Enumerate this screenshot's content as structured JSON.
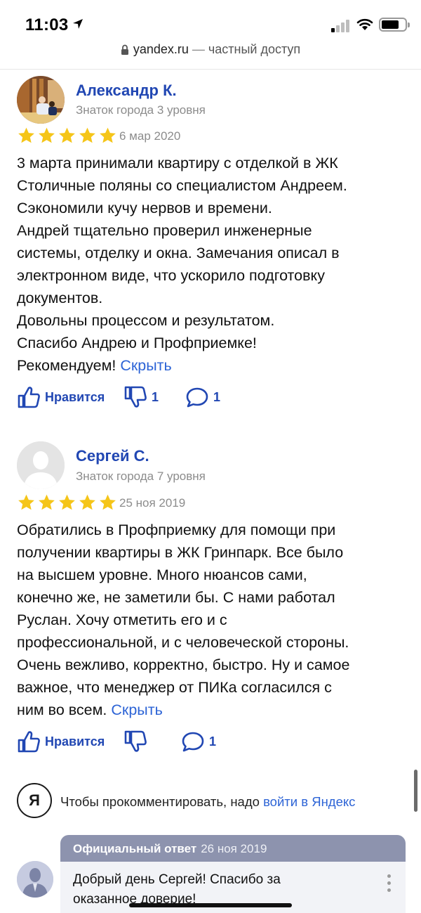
{
  "status_bar": {
    "time": "11:03"
  },
  "browser": {
    "domain": "yandex.ru",
    "separator": " — ",
    "access": "частный доступ"
  },
  "reviews": [
    {
      "author": "Александр К.",
      "level": "Знаток города 3 уровня",
      "rating": 5,
      "date": "6 мар 2020",
      "lines": [
        "3 марта принимали квартиру с отделкой в ЖК",
        "Столичные поляны со специалистом Андреем.",
        "Сэкономили кучу нервов и времени.",
        "Андрей тщательно проверил инженерные",
        "системы, отделку и окна. Замечания описал в",
        "электронном виде, что ускорило подготовку",
        "документов.",
        "Довольны процессом и результатом.",
        "Спасибо Андрею и Профприемке!",
        "Рекомендуем!"
      ],
      "hide_label": "Скрыть",
      "like_label": "Нравится",
      "dislike_count": "1",
      "comment_count": "1"
    },
    {
      "author": "Сергей С.",
      "level": "Знаток города 7 уровня",
      "rating": 5,
      "date": "25 ноя 2019",
      "lines": [
        "Обратились в Профприемку для помощи при",
        "получении квартиры в ЖК Гринпарк. Все было",
        "на высшем уровне. Много нюансов сами,",
        "конечно же, не заметили бы. С нами работал",
        "Руслан. Хочу отметить его и с",
        "профессиональной, и с человеческой стороны.",
        "Очень вежливо, корректно, быстро. Ну и самое",
        "важное, что менеджер от ПИКа согласился с",
        "ним во всем."
      ],
      "hide_label": "Скрыть",
      "like_label": "Нравится",
      "comment_count": "1"
    }
  ],
  "login_prompt": {
    "logo_letter": "Я",
    "text": "Чтобы прокомментировать, надо ",
    "link": "войти в Яндекс"
  },
  "official_answer": {
    "label": "Официальный ответ",
    "date": "26 ноя 2019",
    "lines": [
      "Добрый день Сергей! Спасибо за",
      "оказанное доверие!"
    ]
  },
  "colors": {
    "link": "#2d64d6",
    "author": "#2147b3",
    "star": "#f5c518",
    "official_header": "#8d93ae"
  }
}
